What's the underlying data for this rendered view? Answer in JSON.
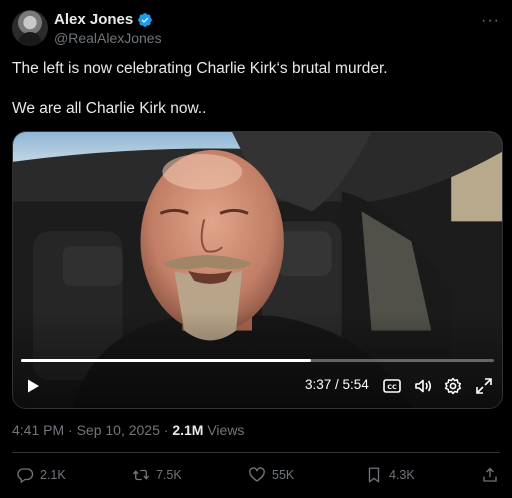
{
  "author": {
    "display_name": "Alex Jones",
    "handle": "@RealAlexJones",
    "verified_color": "#1d9bf0"
  },
  "tweet": {
    "line1": "The left is now celebrating Charlie Kirk‘s brutal murder.",
    "line2": "We are all Charlie Kirk now.."
  },
  "video": {
    "time_display": "3:37 / 5:54",
    "progress": 0.613,
    "controls": [
      "play-icon",
      "captions-icon",
      "volume-icon",
      "settings-icon",
      "fullscreen-icon"
    ]
  },
  "meta": {
    "timestamp": "4:41 PM · Sep 10, 2025 · ",
    "views_count": "2.1M",
    "views_label": " Views"
  },
  "actions": {
    "replies": "2.1K",
    "reposts": "7.5K",
    "likes": "55K",
    "bookmarks": "4.3K"
  },
  "colors": {
    "background": "#000000",
    "text": "#e7e9ea",
    "muted": "#71767b",
    "border": "#2f3336"
  }
}
